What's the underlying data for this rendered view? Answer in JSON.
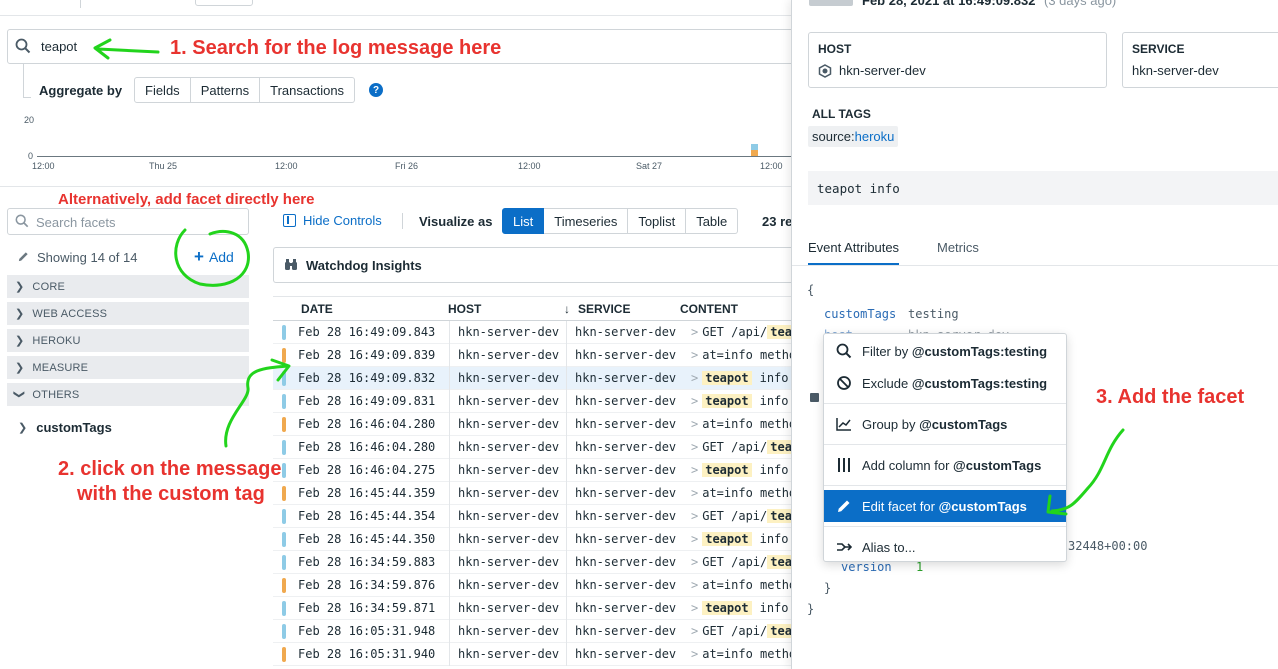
{
  "search": {
    "value": "teapot"
  },
  "aggregate": {
    "label": "Aggregate by",
    "options": [
      "Fields",
      "Patterns",
      "Transactions"
    ]
  },
  "timeline": {
    "y_ticks": [
      "20",
      "0"
    ],
    "x_ticks": [
      "12:00",
      "Thu 25",
      "12:00",
      "Fri 26",
      "12:00",
      "Sat 27",
      "12:00"
    ]
  },
  "facets": {
    "search_placeholder": "Search facets",
    "showing": "Showing 14 of 14",
    "add_label": "Add",
    "groups": [
      "CORE",
      "WEB ACCESS",
      "HEROKU",
      "MEASURE",
      "OTHERS"
    ],
    "others_items": [
      "customTags"
    ]
  },
  "toolbar": {
    "hide_controls": "Hide Controls",
    "visualize_as": "Visualize as",
    "views": [
      "List",
      "Timeseries",
      "Toplist",
      "Table"
    ],
    "result_count": "23 re"
  },
  "watchdog": {
    "label": "Watchdog Insights"
  },
  "table": {
    "columns": {
      "date": "DATE",
      "host": "HOST",
      "service": "SERVICE",
      "content": "CONTENT"
    },
    "rows": [
      {
        "date": "Feb 28 16:49:09.843",
        "host": "hkn-server-dev",
        "service": "hkn-server-dev",
        "pre": "GET /api/",
        "hl": "teapot",
        "post": "",
        "color": "#8ecbe6",
        "selected": false
      },
      {
        "date": "Feb 28 16:49:09.839",
        "host": "hkn-server-dev",
        "service": "hkn-server-dev",
        "pre": "at=info method=",
        "hl": "",
        "post": "",
        "color": "#f0a94f",
        "selected": false
      },
      {
        "date": "Feb 28 16:49:09.832",
        "host": "hkn-server-dev",
        "service": "hkn-server-dev",
        "pre": "",
        "hl": "teapot",
        "post": "info",
        "color": "#8ecbe6",
        "selected": true
      },
      {
        "date": "Feb 28 16:49:09.831",
        "host": "hkn-server-dev",
        "service": "hkn-server-dev",
        "pre": "",
        "hl": "teapot",
        "post": "info",
        "color": "#8ecbe6",
        "selected": false
      },
      {
        "date": "Feb 28 16:46:04.280",
        "host": "hkn-server-dev",
        "service": "hkn-server-dev",
        "pre": "at=info method=",
        "hl": "",
        "post": "",
        "color": "#f0a94f",
        "selected": false
      },
      {
        "date": "Feb 28 16:46:04.280",
        "host": "hkn-server-dev",
        "service": "hkn-server-dev",
        "pre": "GET /api/",
        "hl": "teapot",
        "post": "",
        "color": "#8ecbe6",
        "selected": false
      },
      {
        "date": "Feb 28 16:46:04.275",
        "host": "hkn-server-dev",
        "service": "hkn-server-dev",
        "pre": "",
        "hl": "teapot",
        "post": "info",
        "color": "#8ecbe6",
        "selected": false
      },
      {
        "date": "Feb 28 16:45:44.359",
        "host": "hkn-server-dev",
        "service": "hkn-server-dev",
        "pre": "at=info method=",
        "hl": "",
        "post": "",
        "color": "#f0a94f",
        "selected": false
      },
      {
        "date": "Feb 28 16:45:44.354",
        "host": "hkn-server-dev",
        "service": "hkn-server-dev",
        "pre": "GET /api/",
        "hl": "teapot",
        "post": "",
        "color": "#8ecbe6",
        "selected": false
      },
      {
        "date": "Feb 28 16:45:44.350",
        "host": "hkn-server-dev",
        "service": "hkn-server-dev",
        "pre": "",
        "hl": "teapot",
        "post": "info",
        "color": "#8ecbe6",
        "selected": false
      },
      {
        "date": "Feb 28 16:34:59.883",
        "host": "hkn-server-dev",
        "service": "hkn-server-dev",
        "pre": "GET /api/",
        "hl": "teapot",
        "post": "",
        "color": "#8ecbe6",
        "selected": false
      },
      {
        "date": "Feb 28 16:34:59.876",
        "host": "hkn-server-dev",
        "service": "hkn-server-dev",
        "pre": "at=info method=",
        "hl": "",
        "post": "",
        "color": "#f0a94f",
        "selected": false
      },
      {
        "date": "Feb 28 16:34:59.871",
        "host": "hkn-server-dev",
        "service": "hkn-server-dev",
        "pre": "",
        "hl": "teapot",
        "post": "info",
        "color": "#8ecbe6",
        "selected": false
      },
      {
        "date": "Feb 28 16:05:31.948",
        "host": "hkn-server-dev",
        "service": "hkn-server-dev",
        "pre": "GET /api/",
        "hl": "teapot",
        "post": "",
        "color": "#8ecbe6",
        "selected": false
      },
      {
        "date": "Feb 28 16:05:31.940",
        "host": "hkn-server-dev",
        "service": "hkn-server-dev",
        "pre": "at=info method=",
        "hl": "",
        "post": "",
        "color": "#f0a94f",
        "selected": false
      }
    ]
  },
  "panel": {
    "header_date": "Feb 28, 2021 at 16:49:09.832",
    "header_ago": "(3 days ago)",
    "host_label": "HOST",
    "host_value": "hkn-server-dev",
    "service_label": "SERVICE",
    "service_value": "hkn-server-dev",
    "all_tags_label": "ALL TAGS",
    "tag_key": "source:",
    "tag_value": "heroku",
    "message": "teapot info",
    "tabs": [
      "Event Attributes",
      "Metrics"
    ],
    "attrs": {
      "open_brace": "{",
      "custom_key": "customTags",
      "custom_val": "testing",
      "host_key": "host",
      "host_val": "hkn-server-dev",
      "ts_tail": "32448+00:00",
      "version_key": "version",
      "version_val": "1",
      "inner_close": "}",
      "close_brace": "}"
    }
  },
  "context_menu": {
    "filter_prefix": "Filter by ",
    "filter_bold": "@customTags:testing",
    "exclude_prefix": "Exclude ",
    "exclude_bold": "@customTags:testing",
    "group_prefix": "Group by ",
    "group_bold": "@customTags",
    "column_prefix": "Add column for ",
    "column_bold": "@customTags",
    "facet_prefix": "Edit facet for ",
    "facet_bold": "@customTags",
    "alias": "Alias to..."
  },
  "annotations": {
    "step1": "1. Search for the log message here",
    "alt": "Alternatively, add facet directly here",
    "step2_line1": "2. click on the message",
    "step2_line2": "with the custom tag",
    "step3": "3. Add the facet"
  },
  "colors": {
    "accent": "#0b6ec7",
    "annotation": "#e8332f",
    "arrow": "#22d41c",
    "info_bar": "#8ecbe6",
    "warn_bar": "#f0a94f"
  }
}
